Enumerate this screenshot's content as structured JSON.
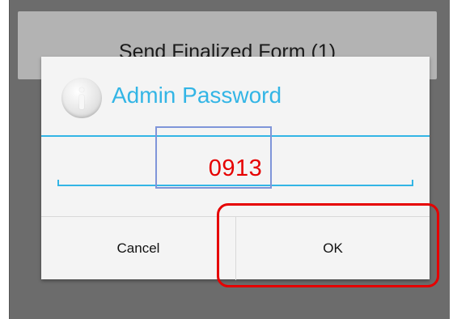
{
  "background": {
    "action_label": "Send Finalized Form (1)"
  },
  "dialog": {
    "title": "Admin Password",
    "icon": "info-icon",
    "password_value": "0913",
    "buttons": {
      "cancel_label": "Cancel",
      "ok_label": "OK"
    }
  },
  "colors": {
    "accent": "#33b5e5",
    "annotation": "#e60000",
    "highlight": "#7f95d9",
    "dim_overlay": "#6c6c6c"
  }
}
